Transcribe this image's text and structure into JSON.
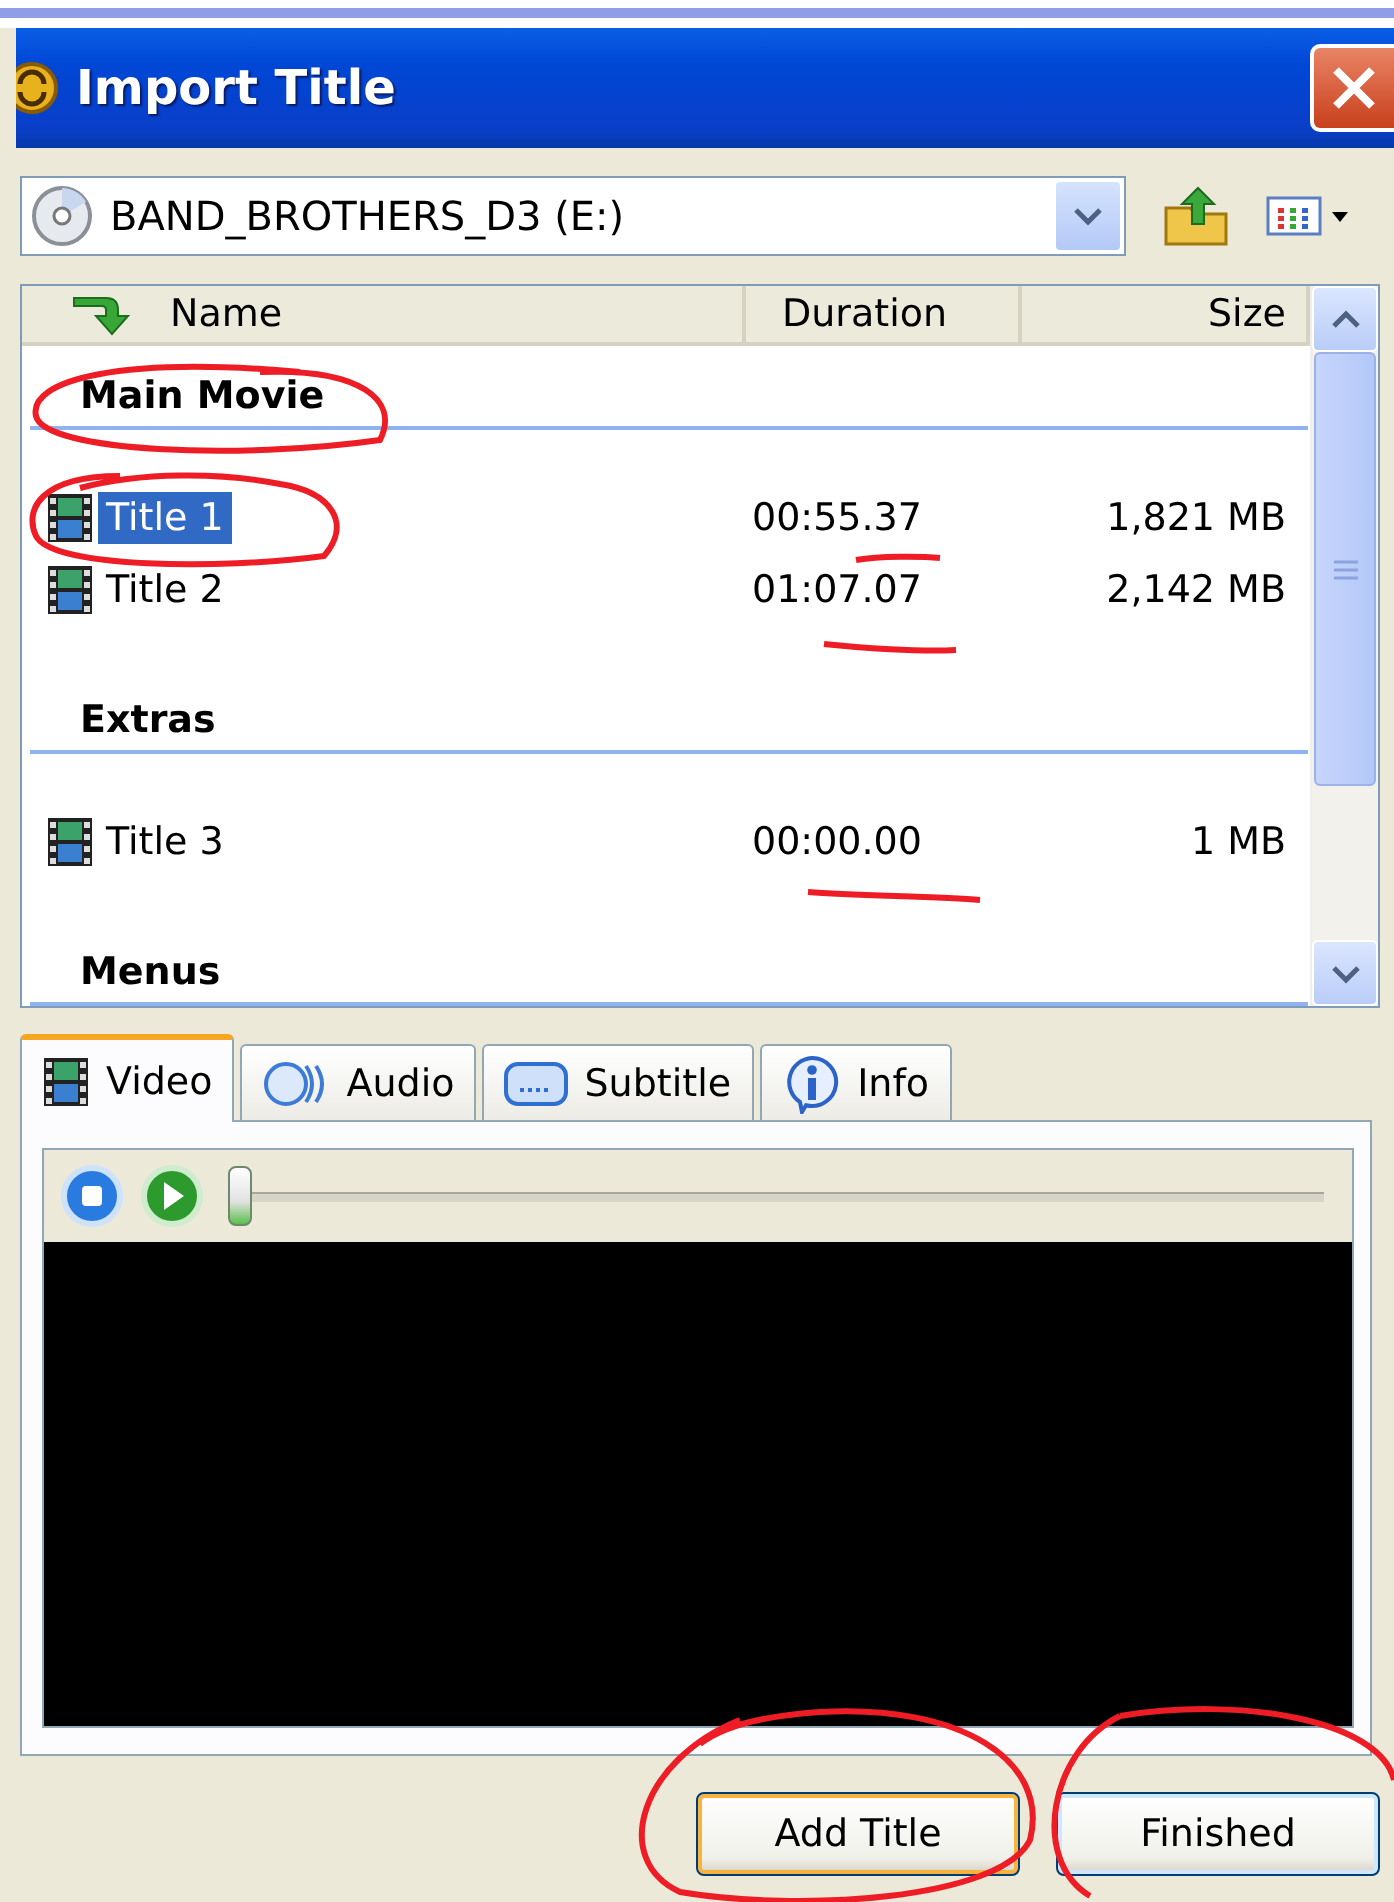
{
  "window": {
    "title": "Import Title"
  },
  "drive": {
    "value": "BAND_BROTHERS_D3 (E:)"
  },
  "columns": [
    "Name",
    "Duration",
    "Size"
  ],
  "groups": [
    {
      "label": "Main Movie",
      "rows": [
        {
          "name": "Title 1",
          "duration": "00:55.37",
          "size": "1,821 MB",
          "selected": true
        },
        {
          "name": "Title 2",
          "duration": "01:07.07",
          "size": "2,142 MB",
          "selected": false
        }
      ]
    },
    {
      "label": "Extras",
      "rows": [
        {
          "name": "Title 3",
          "duration": "00:00.00",
          "size": "1 MB",
          "selected": false
        }
      ]
    },
    {
      "label": "Menus"
    }
  ],
  "tabs": [
    {
      "label": "Video",
      "selected": true
    },
    {
      "label": "Audio",
      "selected": false
    },
    {
      "label": "Subtitle",
      "selected": false
    },
    {
      "label": "Info",
      "selected": false
    }
  ],
  "player": {
    "level": 0
  },
  "buttons": [
    {
      "label": "Add Title",
      "default": true
    },
    {
      "label": "Finished",
      "default": false
    }
  ]
}
